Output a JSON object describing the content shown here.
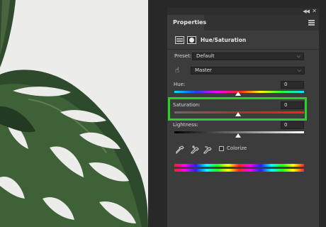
{
  "panel": {
    "tab_label": "Properties",
    "adjustment_title": "Hue/Saturation",
    "preset_label": "Preset:",
    "preset_value": "Default",
    "channel_value": "Master",
    "hue_label": "Hue:",
    "hue_value": "0",
    "saturation_label": "Saturation:",
    "saturation_value": "0",
    "lightness_label": "Lightness:",
    "lightness_value": "0",
    "colorize_label": "Colorize",
    "colorize_checked": false
  },
  "colors": {
    "highlight": "#29d31f",
    "panel_bg": "#3c3c3c"
  },
  "icons": [
    "collapse-icon",
    "close-icon",
    "panel-menu-icon",
    "adjustment-layer-icon",
    "layer-mask-icon",
    "chevron-down-icon",
    "targeted-adjustment-hand-icon",
    "eyedropper-icon",
    "eyedropper-plus-icon",
    "eyedropper-minus-icon"
  ]
}
